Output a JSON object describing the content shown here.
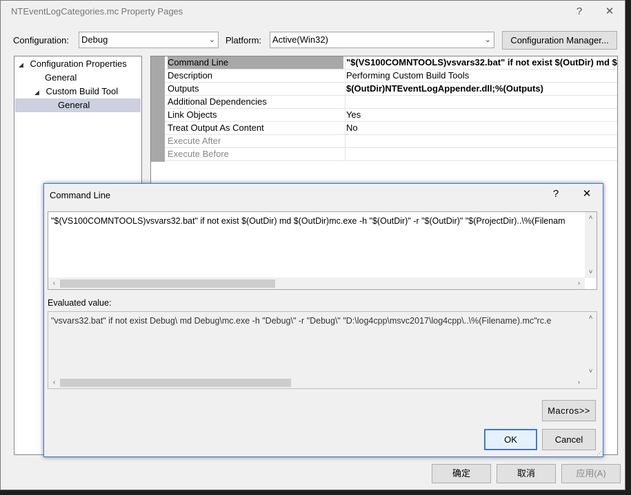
{
  "window": {
    "title": "NTEventLogCategories.mc Property Pages",
    "help_glyph": "?",
    "close_glyph": "✕"
  },
  "config_bar": {
    "configuration_label": "Configuration:",
    "configuration_value": "Debug",
    "platform_label": "Platform:",
    "platform_value": "Active(Win32)",
    "manager_button": "Configuration Manager..."
  },
  "tree": [
    {
      "label": "Configuration Properties",
      "expander": "◢",
      "level": 0
    },
    {
      "label": "General",
      "expander": "",
      "level": 1
    },
    {
      "label": "Custom Build Tool",
      "expander": "◢",
      "level": 1
    },
    {
      "label": "General",
      "expander": "",
      "level": 2,
      "selected": true
    }
  ],
  "properties": [
    {
      "name": "Command Line",
      "value": "\"$(VS100COMNTOOLS)vsvars32.bat\" if not exist $(OutDir) md $",
      "bold": true
    },
    {
      "name": "Description",
      "value": "Performing Custom Build Tools",
      "bold": false
    },
    {
      "name": "Outputs",
      "value": "$(OutDir)NTEventLogAppender.dll;%(Outputs)",
      "bold": true
    },
    {
      "name": "Additional Dependencies",
      "value": "",
      "bold": false
    },
    {
      "name": "Link Objects",
      "value": "Yes",
      "bold": false
    },
    {
      "name": "Treat Output As Content",
      "value": "No",
      "bold": false
    },
    {
      "name": "Execute After",
      "value": "",
      "bold": false
    },
    {
      "name": "Execute Before",
      "value": "",
      "bold": false
    }
  ],
  "bottom_buttons": {
    "ok": "确定",
    "cancel": "取消",
    "apply": "应用(A)"
  },
  "dialog": {
    "title": "Command Line",
    "help_glyph": "?",
    "close_glyph": "✕",
    "command_text": "\"$(VS100COMNTOOLS)vsvars32.bat\" if not exist $(OutDir) md $(OutDir)mc.exe -h \"$(OutDir)\" -r \"$(OutDir)\" \"$(ProjectDir)..\\%(Filenam",
    "evaluated_label": "Evaluated value:",
    "evaluated_text": "\"vsvars32.bat\" if not exist Debug\\ md Debug\\mc.exe -h \"Debug\\\" -r \"Debug\\\" \"D:\\log4cpp\\msvc2017\\log4cpp\\..\\%(Filename).mc\"rc.e",
    "macros_button": "Macros>>",
    "ok_button": "OK",
    "cancel_button": "Cancel",
    "command_scroll_fraction": 0.42,
    "evaluated_scroll_fraction": 0.45
  },
  "icons": {
    "scroll_left": "‹",
    "scroll_right": "›",
    "scroll_up": "˄",
    "scroll_down": "˅",
    "combo_arrow": "⌄",
    "grip": "⋰"
  }
}
